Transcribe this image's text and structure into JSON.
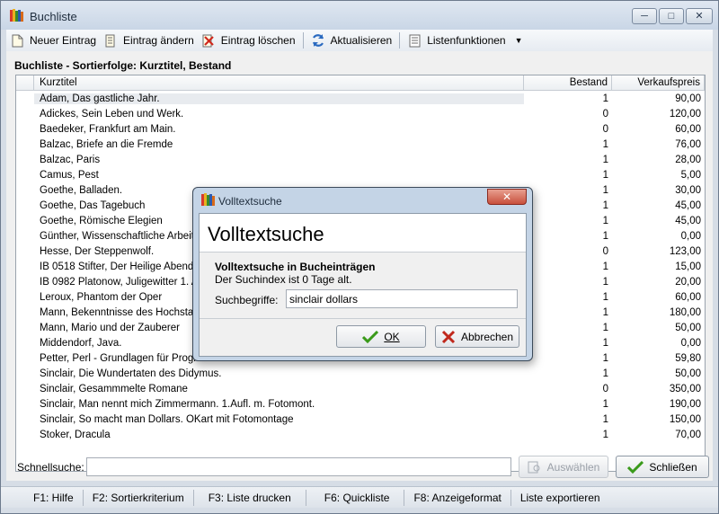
{
  "window": {
    "title": "Buchliste"
  },
  "toolbar": {
    "new_entry": "Neuer Eintrag",
    "edit_entry": "Eintrag ändern",
    "delete_entry": "Eintrag löschen",
    "refresh": "Aktualisieren",
    "list_functions": "Listenfunktionen"
  },
  "list": {
    "title": "Buchliste - Sortierfolge: Kurztitel, Bestand",
    "columns": [
      "Kurztitel",
      "Bestand",
      "Verkaufspreis"
    ],
    "rows": [
      [
        "Adam, Das gastliche Jahr.",
        "1",
        "90,00"
      ],
      [
        "Adickes, Sein Leben und Werk.",
        "0",
        "120,00"
      ],
      [
        "Baedeker, Frankfurt am Main.",
        "0",
        "60,00"
      ],
      [
        "Balzac, Briefe an die Fremde",
        "1",
        "76,00"
      ],
      [
        "Balzac, Paris",
        "1",
        "28,00"
      ],
      [
        "Camus, Pest",
        "1",
        "5,00"
      ],
      [
        "Goethe, Balladen.",
        "1",
        "30,00"
      ],
      [
        "Goethe, Das Tagebuch",
        "1",
        "45,00"
      ],
      [
        "Goethe, Römische Elegien",
        "1",
        "45,00"
      ],
      [
        "Günther, Wissenschaftliche Arbeiten",
        "1",
        "0,00"
      ],
      [
        "Hesse, Der Steppenwolf.",
        "0",
        "123,00"
      ],
      [
        "IB 0518 Stifter, Der Heilige Abend 1",
        "1",
        "15,00"
      ],
      [
        "IB 0982 Platonow, Juligewitter 1. Au",
        "1",
        "20,00"
      ],
      [
        "Leroux, Phantom der Oper",
        "1",
        "60,00"
      ],
      [
        "Mann, Bekenntnisse des Hochstaplers",
        "1",
        "180,00"
      ],
      [
        "Mann, Mario und der Zauberer",
        "1",
        "50,00"
      ],
      [
        "Middendorf, Java.",
        "1",
        "0,00"
      ],
      [
        "Petter, Perl - Grundlagen für Programmierer",
        "1",
        "59,80"
      ],
      [
        "Sinclair, Die Wundertaten des Didymus.",
        "1",
        "50,00"
      ],
      [
        "Sinclair, Gesammmelte Romane",
        "0",
        "350,00"
      ],
      [
        "Sinclair, Man nennt mich Zimmermann. 1.Aufl. m. Fotomont.",
        "1",
        "190,00"
      ],
      [
        "Sinclair, So macht man Dollars. OKart mit Fotomontage",
        "1",
        "150,00"
      ],
      [
        "Stoker, Dracula",
        "1",
        "70,00"
      ]
    ]
  },
  "quick_search": {
    "label": "Schnellsuche:",
    "value": "",
    "select_button": "Auswählen",
    "close_button": "Schließen"
  },
  "status_bar": [
    "F1: Hilfe",
    "F2: Sortierkriterium",
    "F3: Liste drucken",
    "F6: Quickliste",
    "F8: Anzeigeformat",
    "Liste exportieren"
  ],
  "dialog": {
    "window_title": "Volltextsuche",
    "heading": "Volltextsuche",
    "subheading": "Volltextsuche in Bucheinträgen",
    "info": "Der Suchindex ist 0 Tage alt.",
    "search_label": "Suchbegriffe:",
    "search_value": "sinclair dollars",
    "ok_button": "OK",
    "cancel_button": "Abbrechen"
  },
  "colors": {
    "window_frame": "#d6dde6",
    "dialog_frame": "#c4d4e6",
    "ok_check": "#3a9a1a",
    "cancel_x": "#c0281c"
  }
}
